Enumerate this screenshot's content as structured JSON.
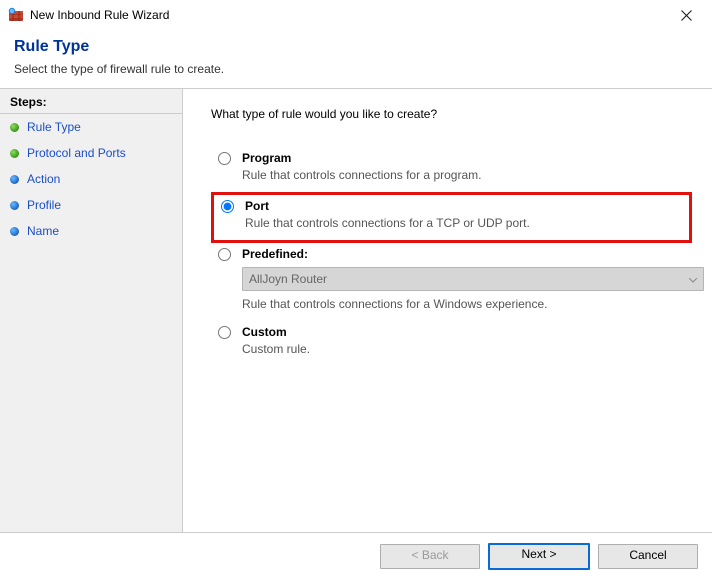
{
  "window": {
    "title": "New Inbound Rule Wizard"
  },
  "header": {
    "title": "Rule Type",
    "subtitle": "Select the type of firewall rule to create."
  },
  "sidebar": {
    "title": "Steps:",
    "items": [
      {
        "label": "Rule Type",
        "current": true
      },
      {
        "label": "Protocol and Ports",
        "current": true
      },
      {
        "label": "Action",
        "current": false
      },
      {
        "label": "Profile",
        "current": false
      },
      {
        "label": "Name",
        "current": false
      }
    ]
  },
  "content": {
    "question": "What type of rule would you like to create?",
    "options": [
      {
        "id": "program",
        "label": "Program",
        "desc": "Rule that controls connections for a program.",
        "selected": false,
        "highlight": false
      },
      {
        "id": "port",
        "label": "Port",
        "desc": "Rule that controls connections for a TCP or UDP port.",
        "selected": true,
        "highlight": true
      },
      {
        "id": "predefined",
        "label": "Predefined:",
        "desc": "Rule that controls connections for a Windows experience.",
        "selected": false,
        "highlight": false,
        "dropdown_value": "AllJoyn Router",
        "dropdown_enabled": false
      },
      {
        "id": "custom",
        "label": "Custom",
        "desc": "Custom rule.",
        "selected": false,
        "highlight": false
      }
    ]
  },
  "footer": {
    "back": "< Back",
    "next": "Next >",
    "cancel": "Cancel",
    "back_enabled": false
  }
}
